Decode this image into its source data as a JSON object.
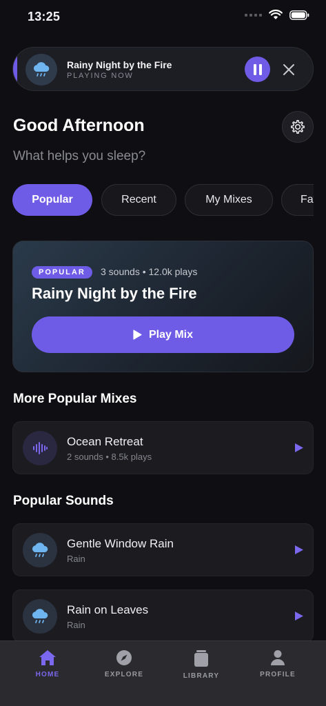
{
  "status": {
    "time": "13:25"
  },
  "now_playing": {
    "title": "Rainy Night by the Fire",
    "subtitle": "PLAYING NOW",
    "art_icon": "rain-cloud-icon"
  },
  "header": {
    "greeting": "Good Afternoon",
    "subtitle": "What helps you sleep?"
  },
  "tabs": [
    {
      "label": "Popular",
      "active": true
    },
    {
      "label": "Recent"
    },
    {
      "label": "My Mixes"
    },
    {
      "label": "Favorites"
    }
  ],
  "featured": {
    "badge": "POPULAR",
    "meta": "3 sounds • 12.0k plays",
    "title": "Rainy Night by the Fire",
    "button_label": "Play Mix"
  },
  "sections": {
    "mixes_title": "More Popular Mixes",
    "sounds_title": "Popular Sounds"
  },
  "mixes": [
    {
      "title": "Ocean Retreat",
      "subtitle": "2 sounds • 8.5k plays",
      "icon": "waveform-icon"
    }
  ],
  "sounds": [
    {
      "title": "Gentle Window Rain",
      "subtitle": "Rain",
      "icon": "rain-cloud-icon"
    },
    {
      "title": "Rain on Leaves",
      "subtitle": "Rain",
      "icon": "rain-cloud-icon"
    }
  ],
  "nav": [
    {
      "label": "HOME",
      "icon": "home-icon",
      "active": true
    },
    {
      "label": "EXPLORE",
      "icon": "compass-icon"
    },
    {
      "label": "LIBRARY",
      "icon": "library-icon"
    },
    {
      "label": "PROFILE",
      "icon": "profile-icon"
    }
  ],
  "colors": {
    "accent": "#6e5ce6",
    "background": "#0f0f13",
    "card": "#1b1b20"
  }
}
